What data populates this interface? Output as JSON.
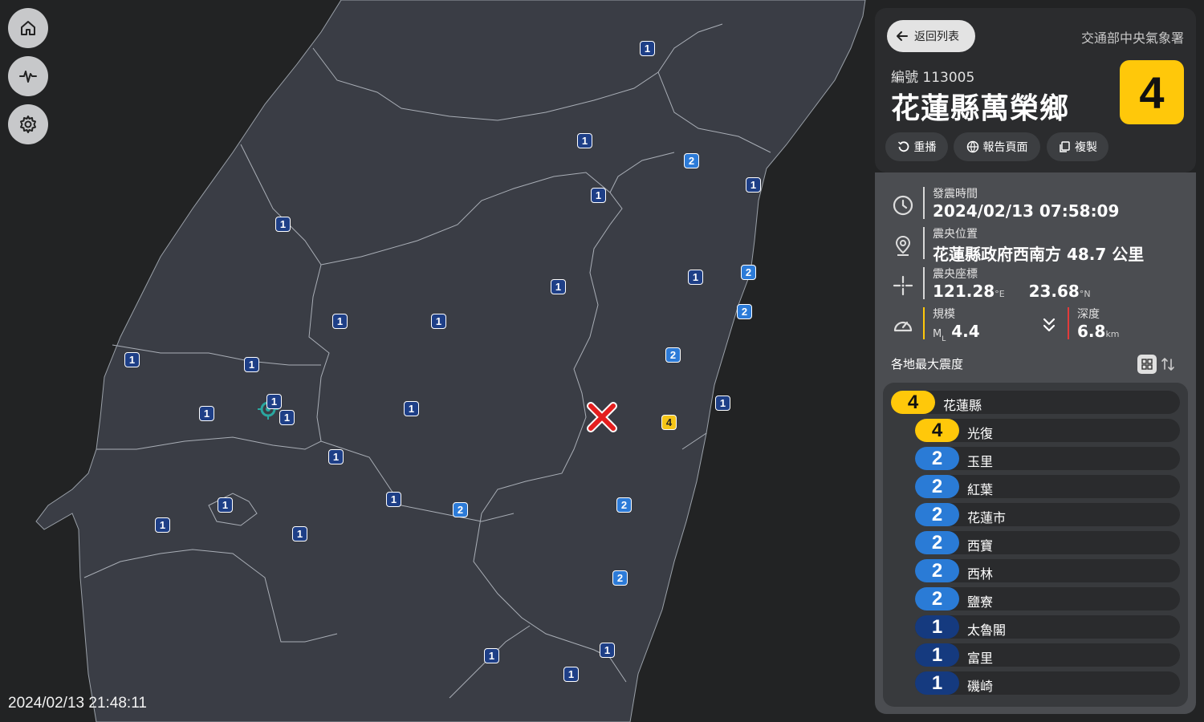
{
  "clock": "2024/02/13 21:48:11",
  "nav": [
    {
      "name": "home-icon"
    },
    {
      "name": "waveform-icon"
    },
    {
      "name": "gear-icon"
    }
  ],
  "map": {
    "stations": [
      {
        "i": "1"
      },
      {
        "i": "1"
      },
      {
        "i": "2"
      },
      {
        "i": "1"
      },
      {
        "i": "1"
      },
      {
        "i": "1"
      },
      {
        "i": "1"
      },
      {
        "i": "1"
      },
      {
        "i": "2"
      },
      {
        "i": "1"
      },
      {
        "i": "1"
      },
      {
        "i": "2"
      },
      {
        "i": "2"
      },
      {
        "i": "1"
      },
      {
        "i": "1"
      },
      {
        "i": "1"
      },
      {
        "i": "1"
      },
      {
        "i": "1"
      },
      {
        "i": "4"
      },
      {
        "i": "1"
      },
      {
        "i": "1"
      },
      {
        "i": "2"
      },
      {
        "i": "2"
      },
      {
        "i": "1"
      },
      {
        "i": "1"
      },
      {
        "i": "2"
      },
      {
        "i": "1"
      },
      {
        "i": "1"
      },
      {
        "i": "1"
      },
      {
        "i": "1"
      }
    ]
  },
  "panel": {
    "back_label": "返回列表",
    "agency": "交通部中央氣象署",
    "report_no": "編號 113005",
    "title": "花蓮縣萬榮鄉",
    "max_intensity": "4",
    "actions": {
      "replay": "重播",
      "report_page": "報告頁面",
      "copy": "複製"
    },
    "time_label": "發震時間",
    "time_value": "2024/02/13 07:58:09",
    "location_label": "震央位置",
    "location_value": "花蓮縣政府西南方 48.7 公里",
    "coord_label": "震央座標",
    "lon": "121.28",
    "lon_unit": "°E",
    "lat": "23.68",
    "lat_unit": "°N",
    "magnitude_label": "規模",
    "magnitude_prefix": "M",
    "magnitude_sub": "L",
    "magnitude_value": "4.4",
    "depth_label": "深度",
    "depth_value": "6.8",
    "depth_unit": "km",
    "section_title": "各地最大震度",
    "list": [
      {
        "i": "4",
        "name": "花蓮縣"
      },
      {
        "i": "4",
        "name": "光復"
      },
      {
        "i": "2",
        "name": "玉里"
      },
      {
        "i": "2",
        "name": "紅葉"
      },
      {
        "i": "2",
        "name": "花蓮市"
      },
      {
        "i": "2",
        "name": "西寶"
      },
      {
        "i": "2",
        "name": "西林"
      },
      {
        "i": "2",
        "name": "鹽寮"
      },
      {
        "i": "1",
        "name": "太魯閣"
      },
      {
        "i": "1",
        "name": "富里"
      },
      {
        "i": "1",
        "name": "磯崎"
      }
    ]
  },
  "colors": {
    "intensity_1": "#1e3f87",
    "intensity_2": "#2c7bd8",
    "intensity_4": "#ffc80a",
    "land": "#3a3d45",
    "sea": "#222324"
  }
}
